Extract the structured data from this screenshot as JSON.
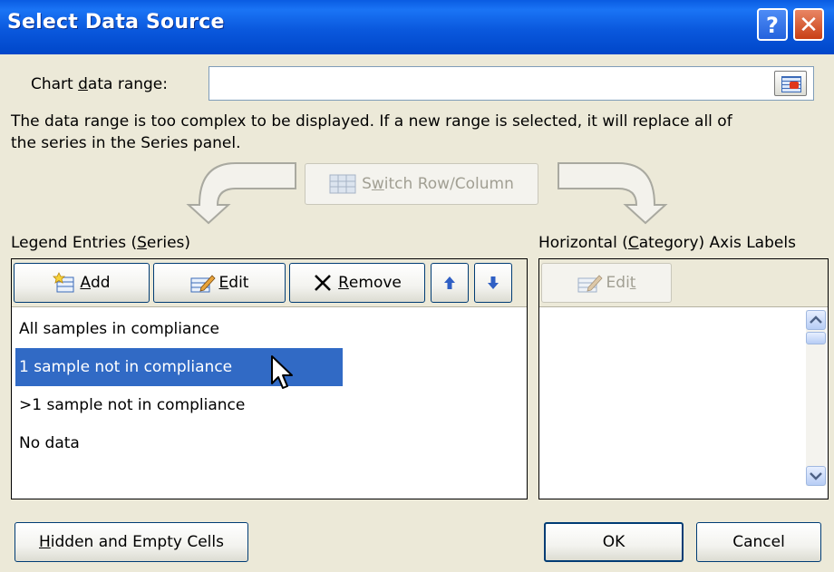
{
  "dialog": {
    "title": "Select Data Source",
    "help_label": "?",
    "close_label": "✕",
    "chart_range_label_pre": "Chart ",
    "chart_range_label_ul": "d",
    "chart_range_label_post": "ata range:",
    "chart_range_value": "",
    "message_line1": "The data range is too complex to be displayed. If a new range is selected, it will replace all of",
    "message_line2": "the series in the Series panel.",
    "switch_pre": "S",
    "switch_ul": "w",
    "switch_post": "itch Row/Column"
  },
  "legend": {
    "header_pre": "Legend Entries (",
    "header_ul": "S",
    "header_post": "eries)",
    "add_ul": "A",
    "add_post": "dd",
    "edit_ul": "E",
    "edit_post": "dit",
    "remove_ul": "R",
    "remove_post": "emove",
    "items": [
      "All samples in compliance",
      "1 sample not in compliance",
      ">1 sample not in compliance",
      "No data"
    ],
    "selected_index": 1
  },
  "axis": {
    "header_pre": "Horizontal (",
    "header_ul": "C",
    "header_post": "ategory) Axis Labels",
    "edit_pre": "Edi",
    "edit_ul": "t"
  },
  "footer": {
    "hidden_ul": "H",
    "hidden_post": "idden and Empty Cells",
    "ok": "OK",
    "cancel": "Cancel"
  },
  "icons": [
    "help-icon",
    "close-icon",
    "range-select-icon",
    "switch-row-column-icon",
    "add-icon",
    "edit-icon",
    "remove-icon",
    "move-up-icon",
    "move-down-icon",
    "scroll-up-icon",
    "scroll-down-icon",
    "mouse-cursor-icon"
  ]
}
